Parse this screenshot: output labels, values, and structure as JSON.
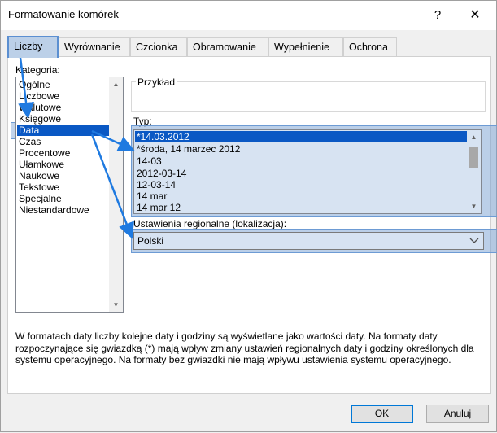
{
  "window": {
    "title": "Formatowanie komórek",
    "help": "?",
    "close": "✕"
  },
  "tabs": [
    "Liczby",
    "Wyrównanie",
    "Czcionka",
    "Obramowanie",
    "Wypełnienie",
    "Ochrona"
  ],
  "active_tab": "Liczby",
  "category": {
    "label": "Kategoria:",
    "items": [
      "Ogólne",
      "Liczbowe",
      "Walutowe",
      "Księgowe",
      "Data",
      "Czas",
      "Procentowe",
      "Ułamkowe",
      "Naukowe",
      "Tekstowe",
      "Specjalne",
      "Niestandardowe"
    ],
    "selected": "Data"
  },
  "sample": {
    "label": "Przykład",
    "value": ""
  },
  "type": {
    "label": "Typ:",
    "items": [
      "*14.03.2012",
      "*środa, 14 marzec 2012",
      "14-03",
      "2012-03-14",
      "12-03-14",
      "14 mar",
      "14 mar 12"
    ],
    "selected": "*14.03.2012"
  },
  "locale": {
    "label": "Ustawienia regionalne (lokalizacja):",
    "value": "Polski"
  },
  "description": "W formatach daty liczby kolejne daty i godziny są wyświetlane jako wartości daty. Na formaty daty rozpoczynające się gwiazdką (*) mają wpływ zmiany ustawień regionalnych daty i godziny określonych dla systemu operacyjnego. Na formaty bez gwiazdki nie mają wpływu ustawienia systemu operacyjnego.",
  "buttons": {
    "ok": "OK",
    "cancel": "Anuluj"
  },
  "colors": {
    "highlight": "#0a58c4",
    "annotation": "#1f7ae0",
    "overlay": "#bcd0e8"
  }
}
